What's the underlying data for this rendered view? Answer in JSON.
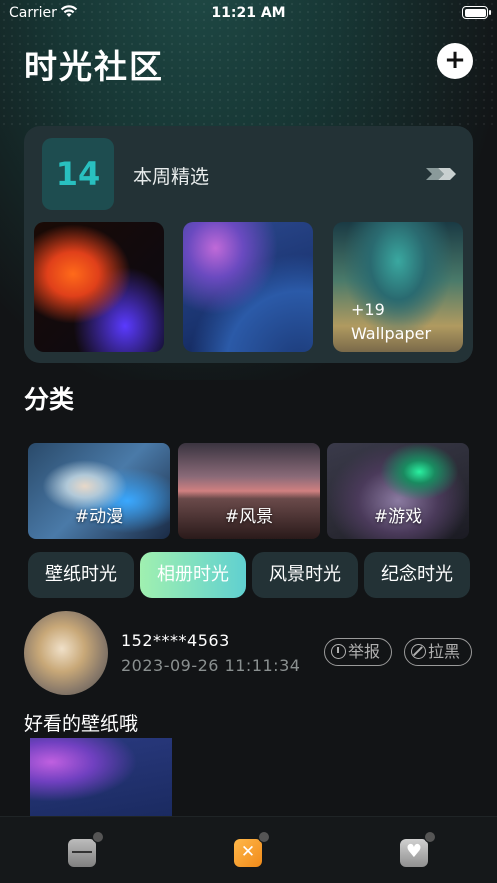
{
  "status_bar": {
    "carrier": "Carrier",
    "time": "11:21 AM"
  },
  "header": {
    "title": "时光社区",
    "add_label": "+"
  },
  "weekly": {
    "number": "14",
    "title": "本周精选",
    "more_count": "+19",
    "more_label": "Wallpaper"
  },
  "categories_section": {
    "title": "分类",
    "items": [
      {
        "label": "#动漫"
      },
      {
        "label": "#风景"
      },
      {
        "label": "#游戏"
      }
    ]
  },
  "filters": {
    "items": [
      {
        "label": "壁纸时光",
        "active": false
      },
      {
        "label": "相册时光",
        "active": true
      },
      {
        "label": "风景时光",
        "active": false
      },
      {
        "label": "纪念时光",
        "active": false
      }
    ]
  },
  "post": {
    "username": "152****4563",
    "timestamp": "2023-09-26 11:11:34",
    "report_label": "举报",
    "block_label": "拉黑",
    "text": "好看的壁纸哦"
  },
  "tab_bar": {
    "tabs": [
      {
        "icon": "wallpaper-icon"
      },
      {
        "icon": "time-icon"
      },
      {
        "icon": "heart-icon"
      }
    ]
  },
  "colors": {
    "background": "#121416",
    "card": "#233236",
    "accent": "#29c0c0",
    "active_gradient_start": "#a0f0b0",
    "active_gradient_end": "#60d0d0"
  }
}
